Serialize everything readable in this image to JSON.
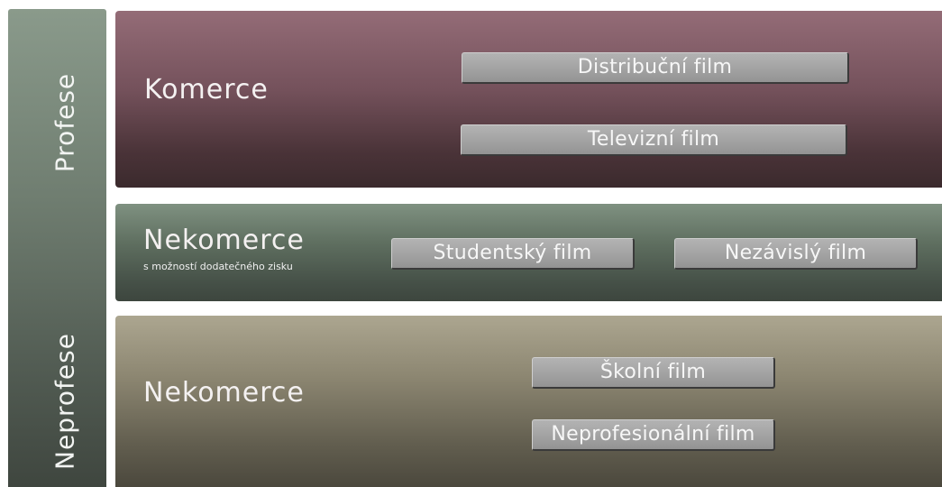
{
  "sidebar": {
    "top_label": "Profese",
    "bottom_label": "Neprofese"
  },
  "bands": {
    "top": {
      "title": "Komerce",
      "films": [
        "Distribuční film",
        "Televizní film"
      ]
    },
    "middle": {
      "title": "Nekomerce",
      "subtitle": "s možností dodatečného zisku",
      "films": [
        "Studentský film",
        "Nezávislý film"
      ]
    },
    "bottom": {
      "title": "Nekomerce",
      "films": [
        "Školní film",
        "Neprofesionální film"
      ]
    }
  },
  "colors": {
    "top_band": "#74515b",
    "middle_band": "#5f6f60",
    "bottom_band": "#8d8772",
    "sidebar": "#6f7d70",
    "film_box": "#a2a2a2"
  }
}
